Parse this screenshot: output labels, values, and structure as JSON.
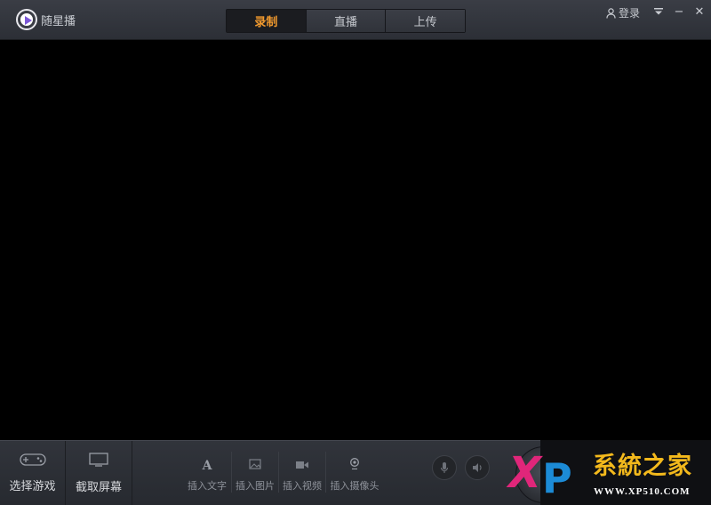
{
  "app": {
    "title": "随星播"
  },
  "tabs": [
    {
      "label": "录制",
      "active": true
    },
    {
      "label": "直播",
      "active": false
    },
    {
      "label": "上传",
      "active": false
    }
  ],
  "header": {
    "login_label": "登录"
  },
  "window_controls": {
    "menu_icon": "dropdown-menu-icon",
    "minimize_glyph": "−",
    "close_glyph": "✕"
  },
  "toolbar": {
    "select_game": "选择游戏",
    "capture_screen": "截取屏幕",
    "insert_text": "插入文字",
    "insert_image": "插入图片",
    "insert_video": "插入视频",
    "insert_camera": "插入摄像头",
    "text_icon_glyph": "A"
  },
  "watermark": {
    "logo_x": "X",
    "logo_p": "P",
    "title": "系統之家",
    "url": "WWW.XP510.COM"
  },
  "colors": {
    "accent": "#f29a2e",
    "background": "#000000",
    "bar": "#2c2f36"
  }
}
